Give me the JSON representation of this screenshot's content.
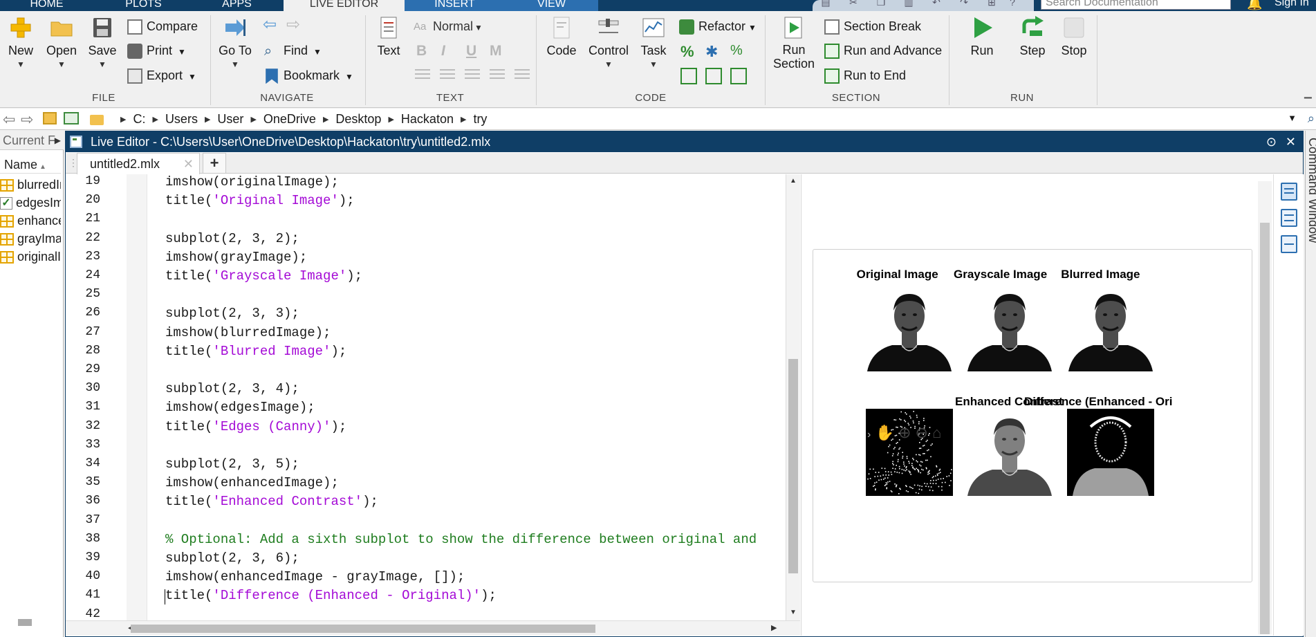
{
  "tabs": [
    {
      "label": "HOME"
    },
    {
      "label": "PLOTS"
    },
    {
      "label": "APPS"
    },
    {
      "label": "LIVE EDITOR"
    },
    {
      "label": "INSERT"
    },
    {
      "label": "VIEW"
    }
  ],
  "search": {
    "placeholder": "Search Documentation"
  },
  "account": {
    "sign_in": "Sign In"
  },
  "ribbon": {
    "file": {
      "label": "FILE",
      "new": "New",
      "open": "Open",
      "save": "Save",
      "compare": "Compare",
      "print": "Print",
      "export": "Export"
    },
    "navigate": {
      "label": "NAVIGATE",
      "goto": "Go To",
      "find": "Find",
      "bookmark": "Bookmark"
    },
    "text": {
      "label": "TEXT",
      "text": "Text",
      "style": "Normal",
      "bold": "B",
      "italic": "I",
      "underline": "U",
      "mono": "M"
    },
    "code": {
      "label": "CODE",
      "code": "Code",
      "control": "Control",
      "task": "Task",
      "refactor": "Refactor"
    },
    "section": {
      "label": "SECTION",
      "run_section": "Run Section",
      "section_break": "Section Break",
      "run_advance": "Run and Advance",
      "run_end": "Run to End"
    },
    "run": {
      "label": "RUN",
      "run": "Run",
      "step": "Step",
      "stop": "Stop"
    }
  },
  "address": {
    "crumbs": [
      "C:",
      "Users",
      "User",
      "OneDrive",
      "Desktop",
      "Hackaton",
      "try"
    ]
  },
  "current_folder": {
    "title": "Current F",
    "column": "Name",
    "items": [
      {
        "name": "blurredImage",
        "type": "var"
      },
      {
        "name": "edgesImage",
        "type": "logical"
      },
      {
        "name": "enhancedImage",
        "type": "var"
      },
      {
        "name": "grayImage",
        "type": "var"
      },
      {
        "name": "originalImage",
        "type": "var"
      }
    ]
  },
  "editor": {
    "title": "Live Editor - C:\\Users\\User\\OneDrive\\Desktop\\Hackaton\\try\\untitled2.mlx",
    "tab": "untitled2.mlx",
    "lines": [
      {
        "n": "19",
        "code": "imshow(originalImage);"
      },
      {
        "n": "20",
        "pre": "title(",
        "str": "'Original Image'",
        "post": ");"
      },
      {
        "n": "21",
        "code": ""
      },
      {
        "n": "22",
        "code": "subplot(2, 3, 2);"
      },
      {
        "n": "23",
        "code": "imshow(grayImage);"
      },
      {
        "n": "24",
        "pre": "title(",
        "str": "'Grayscale Image'",
        "post": ");"
      },
      {
        "n": "25",
        "code": ""
      },
      {
        "n": "26",
        "code": "subplot(2, 3, 3);"
      },
      {
        "n": "27",
        "code": "imshow(blurredImage);"
      },
      {
        "n": "28",
        "pre": "title(",
        "str": "'Blurred Image'",
        "post": ");"
      },
      {
        "n": "29",
        "code": ""
      },
      {
        "n": "30",
        "code": "subplot(2, 3, 4);"
      },
      {
        "n": "31",
        "code": "imshow(edgesImage);"
      },
      {
        "n": "32",
        "pre": "title(",
        "str": "'Edges (Canny)'",
        "post": ");"
      },
      {
        "n": "33",
        "code": ""
      },
      {
        "n": "34",
        "code": "subplot(2, 3, 5);"
      },
      {
        "n": "35",
        "code": "imshow(enhancedImage);"
      },
      {
        "n": "36",
        "pre": "title(",
        "str": "'Enhanced Contrast'",
        "post": ");"
      },
      {
        "n": "37",
        "code": ""
      },
      {
        "n": "38",
        "comment": "% Optional: Add a sixth subplot to show the difference between original and"
      },
      {
        "n": "39",
        "code": "subplot(2, 3, 6);"
      },
      {
        "n": "40",
        "code": "imshow(enhancedImage - grayImage, []);"
      },
      {
        "n": "41",
        "pre": "title(",
        "str": "'Difference (Enhanced - Original)'",
        "post": ");"
      },
      {
        "n": "42",
        "code": ""
      }
    ]
  },
  "figure": {
    "subplots": [
      {
        "title": "Original Image",
        "style": "gray"
      },
      {
        "title": "Grayscale Image",
        "style": "gray"
      },
      {
        "title": "Blurred Image",
        "style": "gray"
      },
      {
        "title": "",
        "style": "edges"
      },
      {
        "title": "Enhanced Contrast",
        "style": "enhanced"
      },
      {
        "title": "Difference (Enhanced - Origina",
        "style": "diff"
      }
    ]
  },
  "command_window": {
    "label": "Command Window"
  },
  "colors": {
    "accent": "#0f3e66",
    "string": "#a40ad6",
    "comment": "#1f7d1f",
    "run_green": "#2ea043"
  }
}
